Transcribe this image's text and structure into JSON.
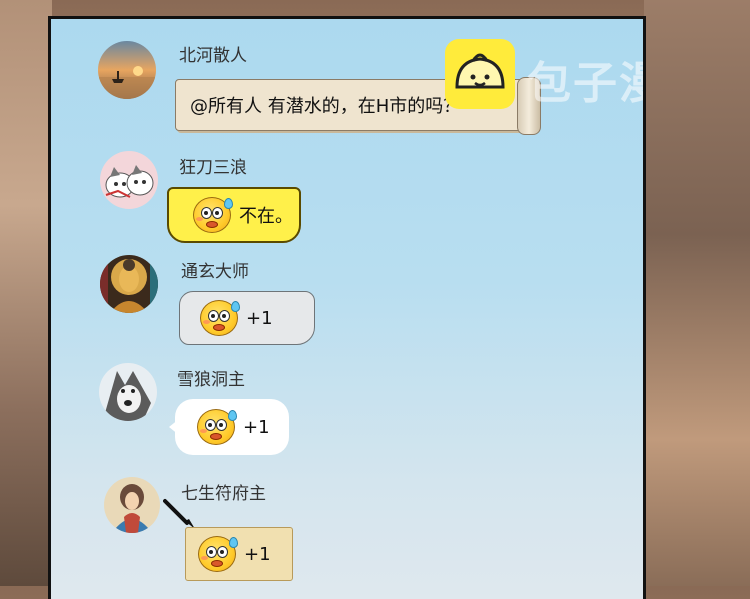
{
  "watermark": {
    "text": "包子漫畫",
    "icon": "baozi-logo-icon"
  },
  "messages": [
    {
      "user": "北河散人",
      "avatar": "sunset-avatar",
      "text": "@所有人  有潜水的，在H市的吗？",
      "bubble_style": "scroll-paper"
    },
    {
      "user": "狂刀三浪",
      "avatar": "cat-avatar",
      "text": "不在。",
      "emoji": "sweat-face-icon",
      "bubble_style": "yellow-banner"
    },
    {
      "user": "通玄大师",
      "avatar": "buddha-avatar",
      "text": "+1",
      "emoji": "sweat-face-icon",
      "bubble_style": "gray-banner"
    },
    {
      "user": "雪狼洞主",
      "avatar": "husky-avatar",
      "text": "+1",
      "emoji": "sweat-face-icon",
      "bubble_style": "white-speech"
    },
    {
      "user": "七生符府主",
      "avatar": "guanyin-avatar",
      "text": "+1",
      "emoji": "sweat-face-icon",
      "bubble_style": "paper-note"
    }
  ],
  "colors": {
    "panel_top": "#acd9ef",
    "panel_bottom": "#dfe8ee",
    "border": "#111111",
    "yellow_bubble": "#fff04a"
  }
}
